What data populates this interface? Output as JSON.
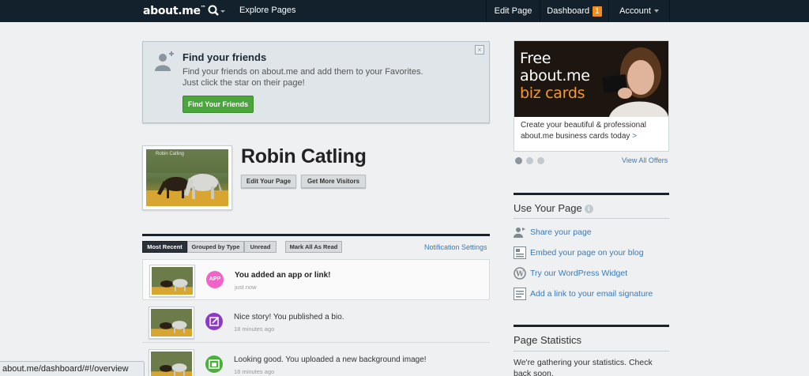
{
  "nav": {
    "logo": "about.me",
    "logo_tm": "™",
    "explore": "Explore Pages",
    "edit_page": "Edit Page",
    "dashboard": "Dashboard",
    "dashboard_count": "1",
    "account": "Account"
  },
  "friends": {
    "title": "Find your friends",
    "line1": "Find your friends on about.me and add them to your Favorites.",
    "line2": "Just click the star on their page!",
    "button": "Find Your Friends",
    "close": "×"
  },
  "profile": {
    "photo_caption": "Robin Catling",
    "name": "Robin Catling",
    "edit_button": "Edit Your Page",
    "visitors_button": "Get More Visitors"
  },
  "notifications": {
    "tabs": {
      "recent": "Most Recent",
      "grouped": "Grouped by Type",
      "unread": "Unread",
      "mark_all": "Mark All As Read"
    },
    "settings_link": "Notification Settings",
    "items": [
      {
        "icon_label": "APP",
        "icon_color": "#f064c8",
        "text": "You added an app or link!",
        "time": "just now"
      },
      {
        "icon_label": "",
        "icon_color": "#8e3ac8",
        "text": "Nice story! You published a bio.",
        "time": "18 minutes ago"
      },
      {
        "icon_label": "",
        "icon_color": "#4cae3c",
        "text": "Looking good. You uploaded a new background image!",
        "time": "18 minutes ago"
      }
    ]
  },
  "ad": {
    "line1": "Free",
    "line2": "about.me",
    "line3": "biz cards",
    "text": "Create your beautiful & professional about.me business cards today",
    "arrow": ">",
    "view_offers": "View All Offers"
  },
  "use_page": {
    "title": "Use Your Page",
    "info": "i",
    "items": [
      {
        "label": "Share your page"
      },
      {
        "label": "Embed your page on your blog"
      },
      {
        "label": "Try our WordPress Widget"
      },
      {
        "label": "Add a link to your email signature"
      }
    ]
  },
  "stats": {
    "title": "Page Statistics",
    "text": "We're gathering your statistics. Check back soon."
  },
  "statusbar": "about.me/dashboard/#!/overview",
  "colors": {
    "nav_bg": "#12212b",
    "link": "#3a7ab3",
    "green_button": "#4aa63a",
    "badge": "#f08c1c"
  }
}
